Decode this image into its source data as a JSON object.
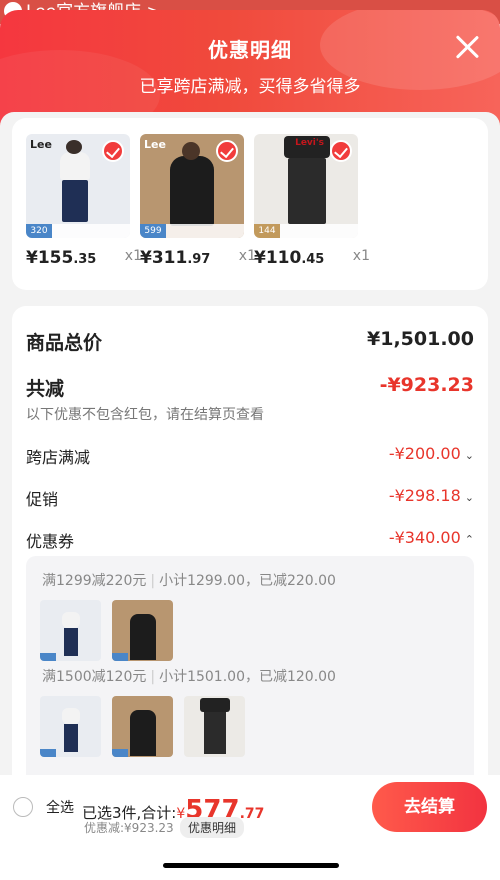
{
  "store_bar": {
    "title": "Lee官方旗舰店 >"
  },
  "header": {
    "title": "优惠明细",
    "subtitle": "已享跨店满减，买得多省得多"
  },
  "products": [
    {
      "brand": "Lee",
      "tag": "320",
      "price_int": "¥155",
      "price_dec": ".35",
      "qty": "x1"
    },
    {
      "brand": "Lee",
      "tag": "599",
      "price_int": "¥311",
      "price_dec": ".97",
      "qty": "x1"
    },
    {
      "brand": "Levi's",
      "tag": "144",
      "price_int": "¥110",
      "price_dec": ".45",
      "qty": "x1"
    }
  ],
  "summary": {
    "total_label": "商品总价",
    "total_value": "¥1,501.00",
    "reduce_label": "共减",
    "reduce_value": "-¥923.23",
    "note": "以下优惠不包含红包，请在结算页查看",
    "rows": [
      {
        "label": "跨店满减",
        "value": "-¥200.00"
      },
      {
        "label": "促销",
        "value": "-¥298.18"
      },
      {
        "label": "优惠券",
        "value": "-¥340.00"
      }
    ]
  },
  "coupons": [
    {
      "rule": "满1299减220元",
      "detail": "小计1299.00，已减220.00"
    },
    {
      "rule": "满1500减120元",
      "detail": "小计1501.00，已减120.00"
    }
  ],
  "bottom": {
    "select_all": "全选",
    "selected_text": "已选3件,合计:",
    "currency": "¥",
    "amount_int": "577",
    "amount_dec": ".77",
    "discount_text": "优惠减:¥923.23",
    "detail_button": "优惠明细",
    "checkout_button": "去结算"
  },
  "colors": {
    "accent": "#f13c3c",
    "discount": "#e8352b"
  }
}
